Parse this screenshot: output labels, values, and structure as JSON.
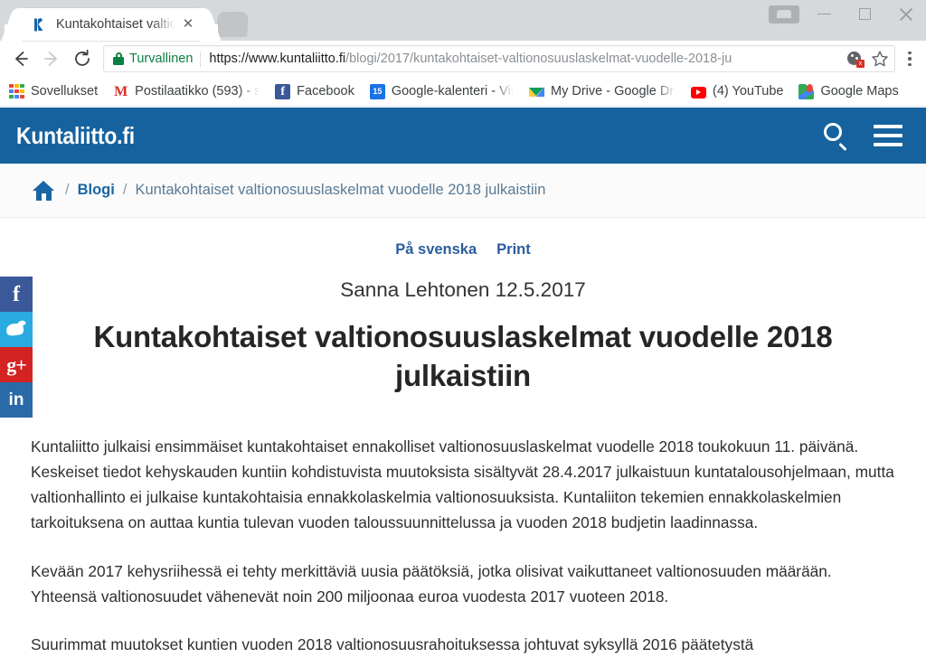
{
  "browser": {
    "tab": {
      "title": "Kuntakohtaiset valtionos",
      "favicon_name": "kuntaliitto-k-favicon",
      "close_label": "✕"
    },
    "newtab_label": "",
    "window_controls": {
      "minimize_label": "",
      "maximize_label": "",
      "close_label": ""
    },
    "nav": {
      "back_label": "←",
      "forward_label": "→",
      "reload_label": "↻"
    },
    "omnibox": {
      "security_label": "Turvallinen",
      "url_host": "https://www.kuntaliitto.fi",
      "url_path": "/blogi/2017/kuntakohtaiset-valtionosuuslaskelmat-vuodelle-2018-ju",
      "cookie_icon_label": "x",
      "star_label": "☆"
    },
    "bookmarks": [
      {
        "label": "Sovellukset",
        "icon": "apps-grid-icon",
        "truncated": false
      },
      {
        "label": "Postilaatikko (593) - s",
        "icon": "gmail-icon",
        "truncated": true
      },
      {
        "label": "Facebook",
        "icon": "facebook-icon",
        "truncated": false
      },
      {
        "label": "Google-kalenteri - Vii",
        "icon": "google-calendar-icon",
        "truncated": true,
        "day": "15"
      },
      {
        "label": "My Drive - Google Dri",
        "icon": "google-drive-icon",
        "truncated": true
      },
      {
        "label": "(4) YouTube",
        "icon": "youtube-icon",
        "truncated": false
      },
      {
        "label": "Google Maps",
        "icon": "google-maps-icon",
        "truncated": false
      }
    ]
  },
  "site": {
    "brand": "Kuntaliitto.fi",
    "header_color": "#15629e",
    "search_icon_name": "search-icon",
    "menu_icon_name": "hamburger-menu-icon"
  },
  "breadcrumb": {
    "home_label": "",
    "separator": "/",
    "items": [
      {
        "label": "Blogi",
        "current": false
      },
      {
        "label": "Kuntakohtaiset valtionosuuslaskelmat vuodelle 2018 julkaistiin",
        "current": true
      }
    ]
  },
  "utility_links": [
    {
      "label": "På svenska"
    },
    {
      "label": "Print"
    }
  ],
  "share_buttons": [
    {
      "network": "facebook",
      "glyph": "f",
      "color": "#3b5998"
    },
    {
      "network": "twitter",
      "glyph": "",
      "color": "#29abe2"
    },
    {
      "network": "googleplus",
      "glyph": "g+",
      "color": "#d32323"
    },
    {
      "network": "linkedin",
      "glyph": "in",
      "color": "#2a6aa8"
    }
  ],
  "article": {
    "byline": "Sanna Lehtonen 12.5.2017",
    "headline": "Kuntakohtaiset valtionosuuslaskelmat vuodelle 2018 julkaistiin",
    "paragraphs": [
      "Kuntaliitto julkaisi ensimmäiset kuntakohtaiset ennakolliset valtionosuuslaskelmat vuodelle 2018 toukokuun 11. päivänä. Keskeiset tiedot kehyskauden kuntiin kohdistuvista muutoksista sisältyvät 28.4.2017 julkaistuun kuntatalousohjelmaan, mutta valtionhallinto ei julkaise kuntakohtaisia ennakkolaskelmia valtionosuuksista. Kuntaliiton tekemien ennakkolaskelmien tarkoituksena on auttaa kuntia tulevan vuoden taloussuunnittelussa ja vuoden 2018 budjetin laadinnassa.",
      "Kevään 2017 kehysriihessä ei tehty merkittäviä uusia päätöksiä, jotka olisivat vaikuttaneet valtionosuuden määrään. Yhteensä valtionosuudet vähenevät noin 200 miljoonaa euroa vuodesta 2017 vuoteen 2018.",
      "Suurimmat muutokset kuntien vuoden 2018 valtionosuusrahoituksessa johtuvat syksyllä 2016 päätetystä"
    ]
  }
}
